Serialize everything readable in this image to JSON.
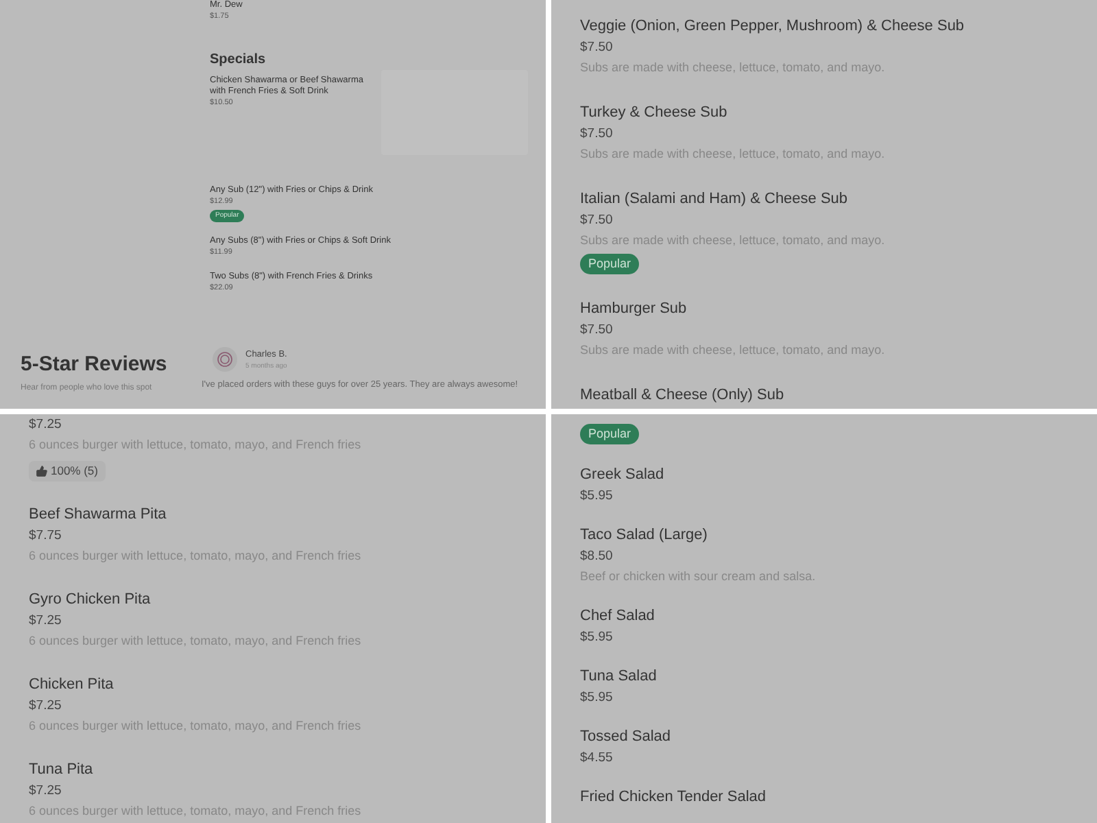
{
  "drinks_tail": [
    {
      "name": "Mr. Dew",
      "price": "$1.75"
    }
  ],
  "specials": {
    "title": "Specials",
    "items": [
      {
        "name": "Chicken Shawarma or Beef Shawarma with French Fries & Soft Drink",
        "price": "$10.50",
        "photo": true
      },
      {
        "name": "Any Sub (12\") with Fries or Chips & Drink",
        "price": "$12.99",
        "badge": "Popular",
        "photo": false
      },
      {
        "name": "Any Subs (8\") with Fries or Chips & Soft Drink",
        "price": "$11.99",
        "photo": false
      },
      {
        "name": "Two Subs (8\") with French Fries & Drinks",
        "price": "$22.09",
        "photo": false
      }
    ]
  },
  "reviews": {
    "title": "5-Star Reviews",
    "subtitle": "Hear from people who love this spot",
    "reviewer": "Charles B.",
    "time": "5 months ago",
    "text": "I've placed orders with these guys for over 25 years. They are always awesome!"
  },
  "subs": [
    {
      "name": "Veggie (Onion, Green Pepper, Mushroom) & Cheese Sub",
      "price": "$7.50",
      "description": "Subs are made with cheese, lettuce, tomato, and mayo."
    },
    {
      "name": "Turkey & Cheese Sub",
      "price": "$7.50",
      "description": "Subs are made with cheese, lettuce, tomato, and mayo."
    },
    {
      "name": "Italian (Salami and Ham) & Cheese Sub",
      "price": "$7.50",
      "description": "Subs are made with cheese, lettuce, tomato, and mayo.",
      "badge": "Popular"
    },
    {
      "name": "Hamburger Sub",
      "price": "$7.50",
      "description": "Subs are made with cheese, lettuce, tomato, and mayo."
    },
    {
      "name": "Meatball & Cheese (Only) Sub"
    }
  ],
  "pitas": [
    {
      "price": "$7.25",
      "description": "6 ounces burger with lettuce, tomato, mayo, and French fries",
      "rating": "100% (5)"
    },
    {
      "name": "Beef Shawarma Pita",
      "price": "$7.75",
      "description": "6 ounces burger with lettuce, tomato, mayo, and French fries"
    },
    {
      "name": "Gyro Chicken Pita",
      "price": "$7.25",
      "description": "6 ounces burger with lettuce, tomato, mayo, and French fries"
    },
    {
      "name": "Chicken Pita",
      "price": "$7.25",
      "description": "6 ounces burger with lettuce, tomato, mayo, and French fries"
    },
    {
      "name": "Tuna Pita",
      "price": "$7.25",
      "description": "6 ounces burger with lettuce, tomato, mayo, and French fries"
    }
  ],
  "salads": [
    {
      "badge": "Popular"
    },
    {
      "name": "Greek Salad",
      "price": "$5.95"
    },
    {
      "name": "Taco Salad (Large)",
      "price": "$8.50",
      "description": "Beef or chicken with sour cream and salsa."
    },
    {
      "name": "Chef Salad",
      "price": "$5.95"
    },
    {
      "name": "Tuna Salad",
      "price": "$5.95"
    },
    {
      "name": "Tossed Salad",
      "price": "$4.55"
    },
    {
      "name": "Fried Chicken Tender Salad"
    }
  ]
}
